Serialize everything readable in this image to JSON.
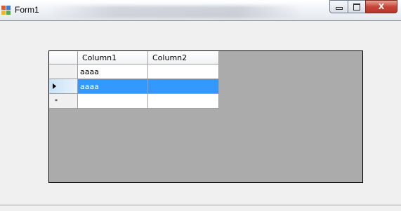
{
  "window": {
    "title": "Form1",
    "icons": {
      "app": "form-app-icon",
      "minimize": "minimize-icon",
      "maximize": "maximize-icon",
      "close": "close-icon"
    },
    "close_glyph": "X"
  },
  "grid": {
    "background_color": "#ababab",
    "selection_color": "#3399ff",
    "columns": [
      "Column1",
      "Column2"
    ],
    "rows": [
      {
        "column1": "aaaa",
        "column2": ""
      },
      {
        "column1": "aaaa",
        "column2": "",
        "selected": true
      },
      {
        "column1": "",
        "column2": "",
        "new_row": true
      }
    ],
    "row_header_icons": {
      "current": "current-row-arrow-icon",
      "new_row": "new-row-star-icon"
    },
    "new_row_glyph": "*"
  }
}
